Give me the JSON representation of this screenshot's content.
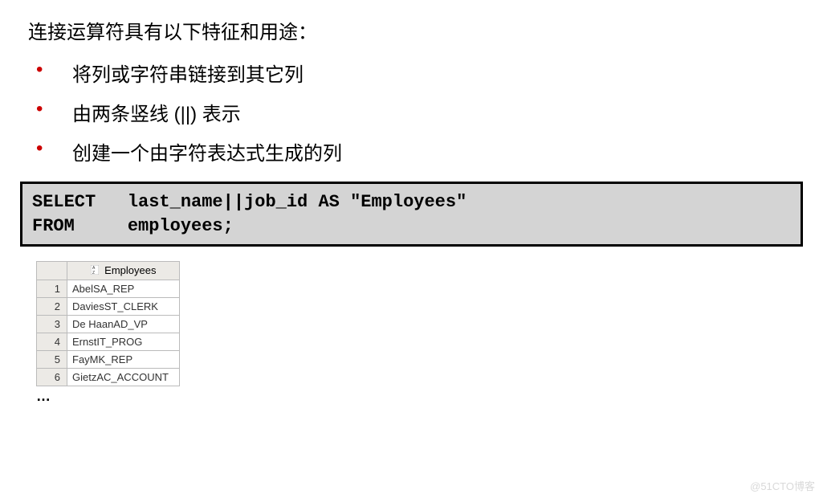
{
  "heading": "连接运算符具有以下特征和用途：",
  "bullets": [
    "将列或字符串链接到其它列",
    "由两条竖线 (||) 表示",
    "创建一个由字符表达式生成的列"
  ],
  "code": "SELECT   last_name||job_id AS \"Employees\"\nFROM     employees;",
  "table": {
    "header": "Employees",
    "rows": [
      {
        "n": "1",
        "v": "AbelSA_REP"
      },
      {
        "n": "2",
        "v": "DaviesST_CLERK"
      },
      {
        "n": "3",
        "v": "De HaanAD_VP"
      },
      {
        "n": "4",
        "v": "ErnstIT_PROG"
      },
      {
        "n": "5",
        "v": "FayMK_REP"
      },
      {
        "n": "6",
        "v": "GietzAC_ACCOUNT"
      }
    ]
  },
  "ellipsis": "…",
  "watermark": "@51CTO博客"
}
